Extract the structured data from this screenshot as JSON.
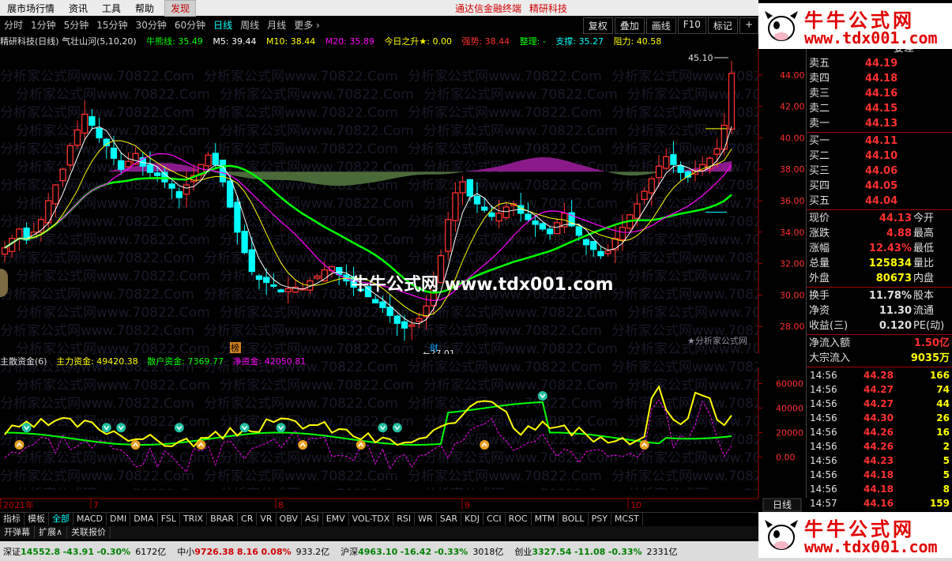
{
  "menubar": {
    "items": [
      "展市场行情",
      "资讯",
      "工具",
      "帮助"
    ],
    "discover": "发现",
    "promo1": "通达信金融终端",
    "promo2": "精研科技"
  },
  "periods": {
    "items": [
      "分时",
      "1分钟",
      "5分钟",
      "15分钟",
      "30分钟",
      "60分钟",
      "日线",
      "周线",
      "月线",
      "更多"
    ],
    "active": "日线",
    "more_arrow": "›",
    "right_buttons": [
      "复权",
      "叠加",
      "画线",
      "F10",
      "标记"
    ],
    "plus": "+"
  },
  "info": {
    "title": "精研科技(日线) 气壮山河(5,10,20)",
    "niu": "牛熊线: 35.49",
    "m5": "M5: 39.44",
    "m10": "M10: 38.44",
    "m20": "M20: 35.89",
    "today": "今日之升★: 0.00",
    "strong": "强势: 38.44",
    "arrange": "整理: -",
    "support": "支撑: 35.27",
    "resist": "阻力: 40.58"
  },
  "main_chart": {
    "high_label": "45.10",
    "low_label": "27.01",
    "y_ticks": [
      "44.00",
      "42.00",
      "40.00",
      "38.00",
      "36.00",
      "34.00",
      "32.00",
      "30.00",
      "28.00"
    ],
    "badge_bang": "榜",
    "badge_cai": "财"
  },
  "sub_info": {
    "title": "主散资金(6)",
    "main": "主力资金: 49420.38",
    "retail": "散户资金: 7369.77",
    "net": "净资金: 42050.81"
  },
  "sub_chart": {
    "y_ticks": [
      "60000",
      "40000",
      "20000",
      "0.00"
    ]
  },
  "xaxis": {
    "labels": [
      "2021年",
      "7",
      "8",
      "9",
      "10"
    ],
    "period": "日线"
  },
  "indicator_tabs": [
    "指标",
    "模板",
    "全部",
    "MACD",
    "DMI",
    "DMA",
    "FSL",
    "TRIX",
    "BRAR",
    "CR",
    "VR",
    "OBV",
    "ASI",
    "EMV",
    "VOL-TDX",
    "RSI",
    "WR",
    "SAR",
    "KDJ",
    "CCI",
    "ROC",
    "MTM",
    "BOLL",
    "PSY",
    "MCST"
  ],
  "indicator_active": "全部",
  "sub_tabs": [
    "开弹幕",
    "扩展∧",
    "关联报价"
  ],
  "quote": {
    "cutoff_label": "委差",
    "sell": [
      {
        "label": "卖五",
        "price": "44.19"
      },
      {
        "label": "卖四",
        "price": "44.18"
      },
      {
        "label": "卖三",
        "price": "44.16"
      },
      {
        "label": "卖二",
        "price": "44.15"
      },
      {
        "label": "卖一",
        "price": "44.13"
      }
    ],
    "buy": [
      {
        "label": "买一",
        "price": "44.11"
      },
      {
        "label": "买二",
        "price": "44.10"
      },
      {
        "label": "买三",
        "price": "44.06"
      },
      {
        "label": "买四",
        "price": "44.05"
      },
      {
        "label": "买五",
        "price": "44.04"
      }
    ],
    "stats": [
      {
        "label": "现价",
        "value": "44.13",
        "label2": "今开"
      },
      {
        "label": "涨跌",
        "value": "4.88",
        "label2": "最高"
      },
      {
        "label": "涨幅",
        "value": "12.43%",
        "label2": "最低"
      },
      {
        "label": "总量",
        "value": "125834",
        "label2": "量比"
      },
      {
        "label": "外盘",
        "value": "80673",
        "label2": "内盘"
      }
    ],
    "stats2": [
      {
        "label": "换手",
        "value": "11.78%",
        "label2": "股本"
      },
      {
        "label": "净资",
        "value": "11.30",
        "label2": "流通"
      },
      {
        "label": "收益(三)",
        "value": "0.120",
        "label2": "PE(动)"
      }
    ],
    "flow": [
      {
        "label": "净流入额",
        "value": "1.50亿"
      },
      {
        "label": "大宗流入",
        "value": "9035万"
      }
    ],
    "ticks": [
      {
        "time": "14:56",
        "price": "44.28",
        "vol": "166"
      },
      {
        "time": "14:56",
        "price": "44.27",
        "vol": "74"
      },
      {
        "time": "14:56",
        "price": "44.27",
        "vol": "44"
      },
      {
        "time": "14:56",
        "price": "44.30",
        "vol": "26"
      },
      {
        "time": "14:56",
        "price": "44.26",
        "vol": "16"
      },
      {
        "time": "14:56",
        "price": "44.26",
        "vol": "2"
      },
      {
        "time": "14:56",
        "price": "44.23",
        "vol": "5"
      },
      {
        "time": "14:56",
        "price": "44.18",
        "vol": "5"
      },
      {
        "time": "14:56",
        "price": "44.18",
        "vol": "8"
      },
      {
        "time": "14:57",
        "price": "44.16",
        "vol": "159"
      }
    ]
  },
  "status": {
    "items": [
      {
        "name": "深证",
        "value": "14552.8",
        "chg": "-43.91",
        "pct": "-0.30%",
        "vol": "6172亿",
        "dir": "down"
      },
      {
        "name": "中小",
        "value": "9726.38",
        "chg": "8.16",
        "pct": "0.08%",
        "vol": "933.2亿",
        "dir": "up"
      },
      {
        "name": "沪深",
        "value": "4963.10",
        "chg": "-16.42",
        "pct": "-0.33%",
        "vol": "3018亿",
        "dir": "down"
      },
      {
        "name": "创业",
        "value": "3327.54",
        "chg": "-11.08",
        "pct": "-0.33%",
        "vol": "2331亿",
        "dir": "down"
      }
    ]
  },
  "logo": {
    "cn": "牛牛公式网",
    "url": "www.tdx001.com"
  },
  "watermark": {
    "main": "牛牛公式网 www.tdx001.com",
    "small": "★分析家公式网",
    "bg_text": "分析家公式网www.70822.Com"
  },
  "colors": {
    "up": "#ff3030",
    "down": "#00ffff",
    "ma5": "#ffffff",
    "ma10": "#ffff00",
    "ma20": "#ff00ff",
    "niu": "#00ff00",
    "fill_pos": "#8a1a8a",
    "fill_neg": "#4a6a3a"
  }
}
